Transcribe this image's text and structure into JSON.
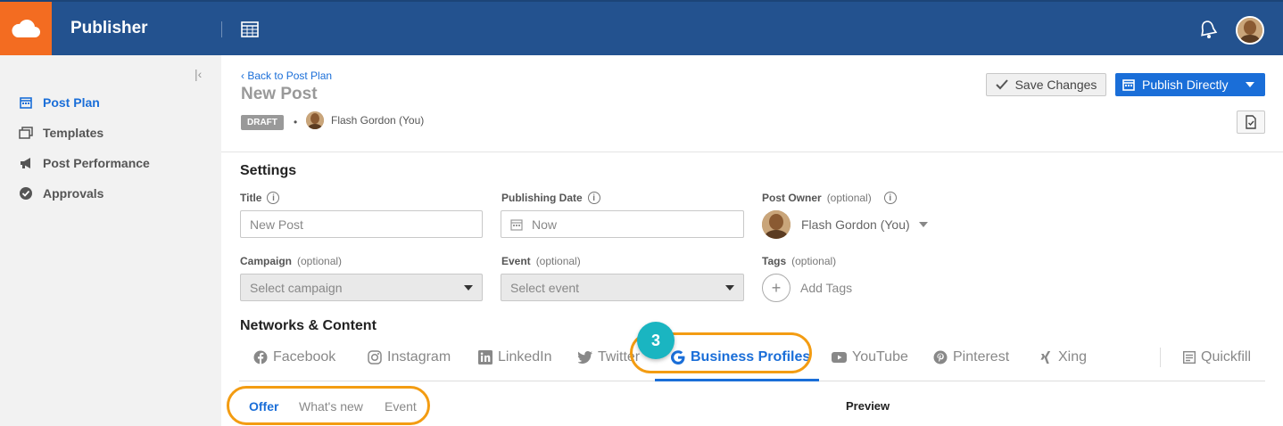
{
  "app": {
    "title": "Publisher"
  },
  "sidebar": {
    "items": [
      {
        "label": "Post Plan",
        "icon": "calendar-icon",
        "active": true
      },
      {
        "label": "Templates",
        "icon": "templates-icon",
        "active": false
      },
      {
        "label": "Post Performance",
        "icon": "megaphone-icon",
        "active": false
      },
      {
        "label": "Approvals",
        "icon": "check-circle-icon",
        "active": false
      }
    ]
  },
  "header": {
    "back_label": "Back to Post Plan",
    "post_title": "New Post",
    "status_badge": "DRAFT",
    "separator": "•",
    "owner_name": "Flash Gordon (You)",
    "save_label": "Save Changes",
    "publish_label": "Publish Directly"
  },
  "settings": {
    "heading": "Settings",
    "title_label": "Title",
    "title_value": "New Post",
    "date_label": "Publishing Date",
    "date_value": "Now",
    "owner_label": "Post Owner",
    "owner_optional": "(optional)",
    "owner_value": "Flash Gordon (You)",
    "campaign_label": "Campaign",
    "campaign_optional": "(optional)",
    "campaign_placeholder": "Select campaign",
    "event_label": "Event",
    "event_optional": "(optional)",
    "event_placeholder": "Select event",
    "tags_label": "Tags",
    "tags_optional": "(optional)",
    "tags_action": "Add Tags"
  },
  "networks": {
    "heading": "Networks & Content",
    "tabs": [
      {
        "label": "Facebook",
        "icon": "facebook-icon"
      },
      {
        "label": "Instagram",
        "icon": "instagram-icon"
      },
      {
        "label": "LinkedIn",
        "icon": "linkedin-icon"
      },
      {
        "label": "Twitter",
        "icon": "twitter-icon"
      },
      {
        "label": "Business Profiles",
        "icon": "google-icon",
        "active": true
      },
      {
        "label": "YouTube",
        "icon": "youtube-icon"
      },
      {
        "label": "Pinterest",
        "icon": "pinterest-icon"
      },
      {
        "label": "Xing",
        "icon": "xing-icon"
      },
      {
        "label": "Quickfill",
        "icon": "quickfill-icon"
      }
    ],
    "step_number": "3",
    "subtabs": [
      {
        "label": "Offer",
        "active": true
      },
      {
        "label": "What's new"
      },
      {
        "label": "Event"
      }
    ],
    "preview_label": "Preview"
  },
  "colors": {
    "brand_orange": "#f36c21",
    "topbar_blue": "#23528f",
    "accent_blue": "#1a6ed8",
    "highlight_orange": "#f39c12",
    "step_teal": "#1ab5c1"
  }
}
